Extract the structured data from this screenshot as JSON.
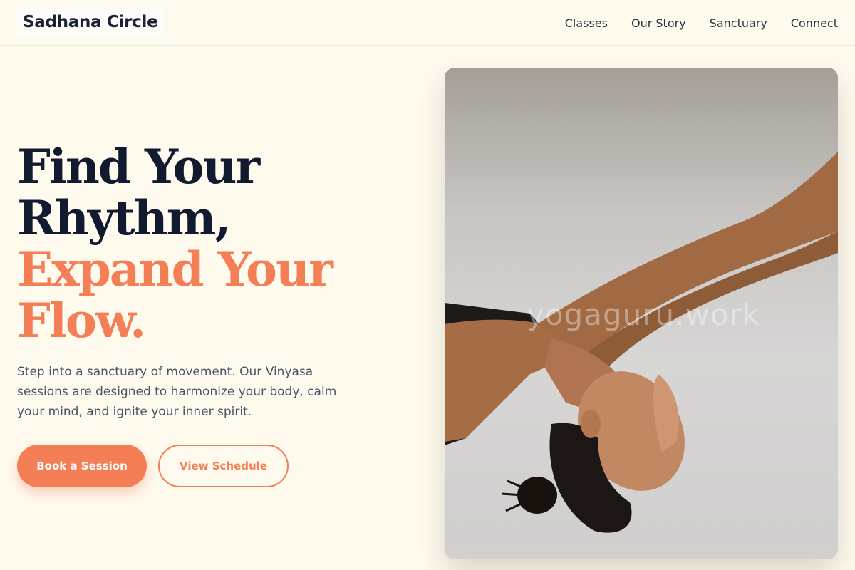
{
  "brand": {
    "name": "Sadhana Circle"
  },
  "nav": {
    "items": [
      {
        "label": "Classes"
      },
      {
        "label": "Our Story"
      },
      {
        "label": "Sanctuary"
      },
      {
        "label": "Connect"
      }
    ]
  },
  "hero": {
    "title_line1": "Find Your",
    "title_line2": "Rhythm,",
    "title_line3": "Expand Your",
    "title_line4": "Flow.",
    "description": "Step into a sanctuary of movement. Our Vinyasa sessions are designed to harmonize your body, calm your mind, and ignite your inner spirit.",
    "primary_button": "Book a Session",
    "secondary_button": "View Schedule",
    "image_watermark": "yogaguru.work"
  },
  "colors": {
    "background": "#fefaee",
    "accent": "#f47e55",
    "heading": "#121a30",
    "body_text": "#4b5466"
  }
}
